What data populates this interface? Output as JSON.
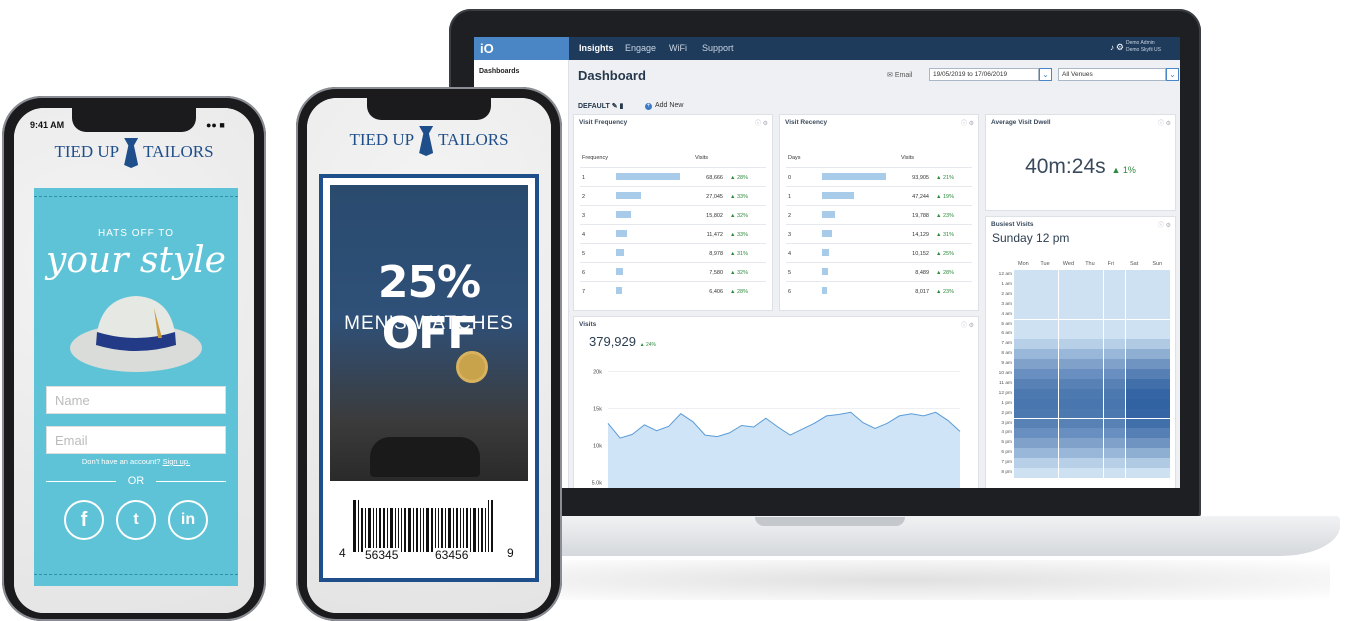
{
  "laptop": {
    "nav": {
      "logo": "iO",
      "items": [
        "Insights",
        "Engage",
        "WiFi",
        "Support"
      ],
      "active": "Insights",
      "user_name": "Demo Admin",
      "user_org": "Demo Skyfii US"
    },
    "sidebar": {
      "label": "Dashboards"
    },
    "header": {
      "title": "Dashboard",
      "email_label": "Email",
      "date_range": "19/05/2019 to 17/06/2019",
      "venue": "All Venues",
      "default_label": "DEFAULT",
      "add_new": "Add New"
    },
    "visit_frequency": {
      "title": "Visit Frequency",
      "col1": "Frequency",
      "col2": "Visits",
      "rows": [
        {
          "label": "1",
          "bar": 1.0,
          "visits": "68,666",
          "change": "28%"
        },
        {
          "label": "2",
          "bar": 0.39,
          "visits": "27,045",
          "change": "33%"
        },
        {
          "label": "3",
          "bar": 0.23,
          "visits": "15,802",
          "change": "32%"
        },
        {
          "label": "4",
          "bar": 0.17,
          "visits": "11,472",
          "change": "33%"
        },
        {
          "label": "5",
          "bar": 0.13,
          "visits": "8,978",
          "change": "31%"
        },
        {
          "label": "6",
          "bar": 0.11,
          "visits": "7,580",
          "change": "32%"
        },
        {
          "label": "7",
          "bar": 0.09,
          "visits": "6,406",
          "change": "28%"
        }
      ]
    },
    "visit_recency": {
      "title": "Visit Recency",
      "col1": "Days",
      "col2": "Visits",
      "rows": [
        {
          "label": "0",
          "bar": 1.0,
          "visits": "93,905",
          "change": "21%"
        },
        {
          "label": "1",
          "bar": 0.5,
          "visits": "47,244",
          "change": "19%"
        },
        {
          "label": "2",
          "bar": 0.21,
          "visits": "19,788",
          "change": "23%"
        },
        {
          "label": "3",
          "bar": 0.15,
          "visits": "14,129",
          "change": "31%"
        },
        {
          "label": "4",
          "bar": 0.11,
          "visits": "10,152",
          "change": "25%"
        },
        {
          "label": "5",
          "bar": 0.09,
          "visits": "8,489",
          "change": "28%"
        },
        {
          "label": "6",
          "bar": 0.085,
          "visits": "8,017",
          "change": "23%"
        }
      ]
    },
    "dwell": {
      "title": "Average Visit Dwell",
      "value": "40m:24s",
      "change": "1%"
    },
    "busiest": {
      "title": "Busiest Visits",
      "value": "Sunday 12 pm",
      "days": [
        "Mon",
        "Tue",
        "Wed",
        "Thu",
        "Fri",
        "Sat",
        "Sun"
      ],
      "hours": [
        "12 am",
        "1 am",
        "2 am",
        "3 am",
        "4 am",
        "5 am",
        "6 am",
        "7 am",
        "8 am",
        "9 am",
        "10 am",
        "11 am",
        "12 pm",
        "1 pm",
        "2 pm",
        "3 pm",
        "4 pm",
        "5 pm",
        "6 pm",
        "7 pm",
        "8 pm"
      ]
    },
    "visits": {
      "title": "Visits",
      "value": "379,929",
      "change": "24%",
      "y_ticks": [
        "20k",
        "15k",
        "10k",
        "5.0k"
      ]
    }
  },
  "chart_data": {
    "type": "area",
    "title": "Visits",
    "ylim": [
      3000,
      22000
    ],
    "values": [
      13000,
      11000,
      11500,
      12800,
      12000,
      12600,
      14300,
      13200,
      11400,
      11200,
      11700,
      12700,
      12500,
      13700,
      12500,
      11400,
      12200,
      13000,
      14000,
      14200,
      14500,
      13100,
      12300,
      13000,
      14000,
      14300,
      14000,
      14500,
      13400,
      11900
    ]
  },
  "phone_left": {
    "status_time": "9:41 AM",
    "brand_left": "TIED UP",
    "brand_right": "TAILORS",
    "tagline_small": "HATS OFF TO",
    "tagline_script": "your style",
    "name_placeholder": "Name",
    "email_placeholder": "Email",
    "signup_text": "Don't have an account?",
    "signup_link": "Sign up.",
    "or": "OR",
    "social": [
      "f",
      "t",
      "in"
    ]
  },
  "phone_right": {
    "brand_left": "TIED UP",
    "brand_right": "TAILORS",
    "offer": "25% OFF",
    "offer_sub": "MEN'S WATCHES",
    "barcode_digits": [
      "4",
      "56345",
      "63456",
      "9"
    ]
  },
  "colors": {
    "nav": "#1f3b5c",
    "accent": "#4a86c5",
    "teal": "#5ec3d6",
    "brand": "#1f4f8a",
    "positive": "#2e8b3e"
  }
}
